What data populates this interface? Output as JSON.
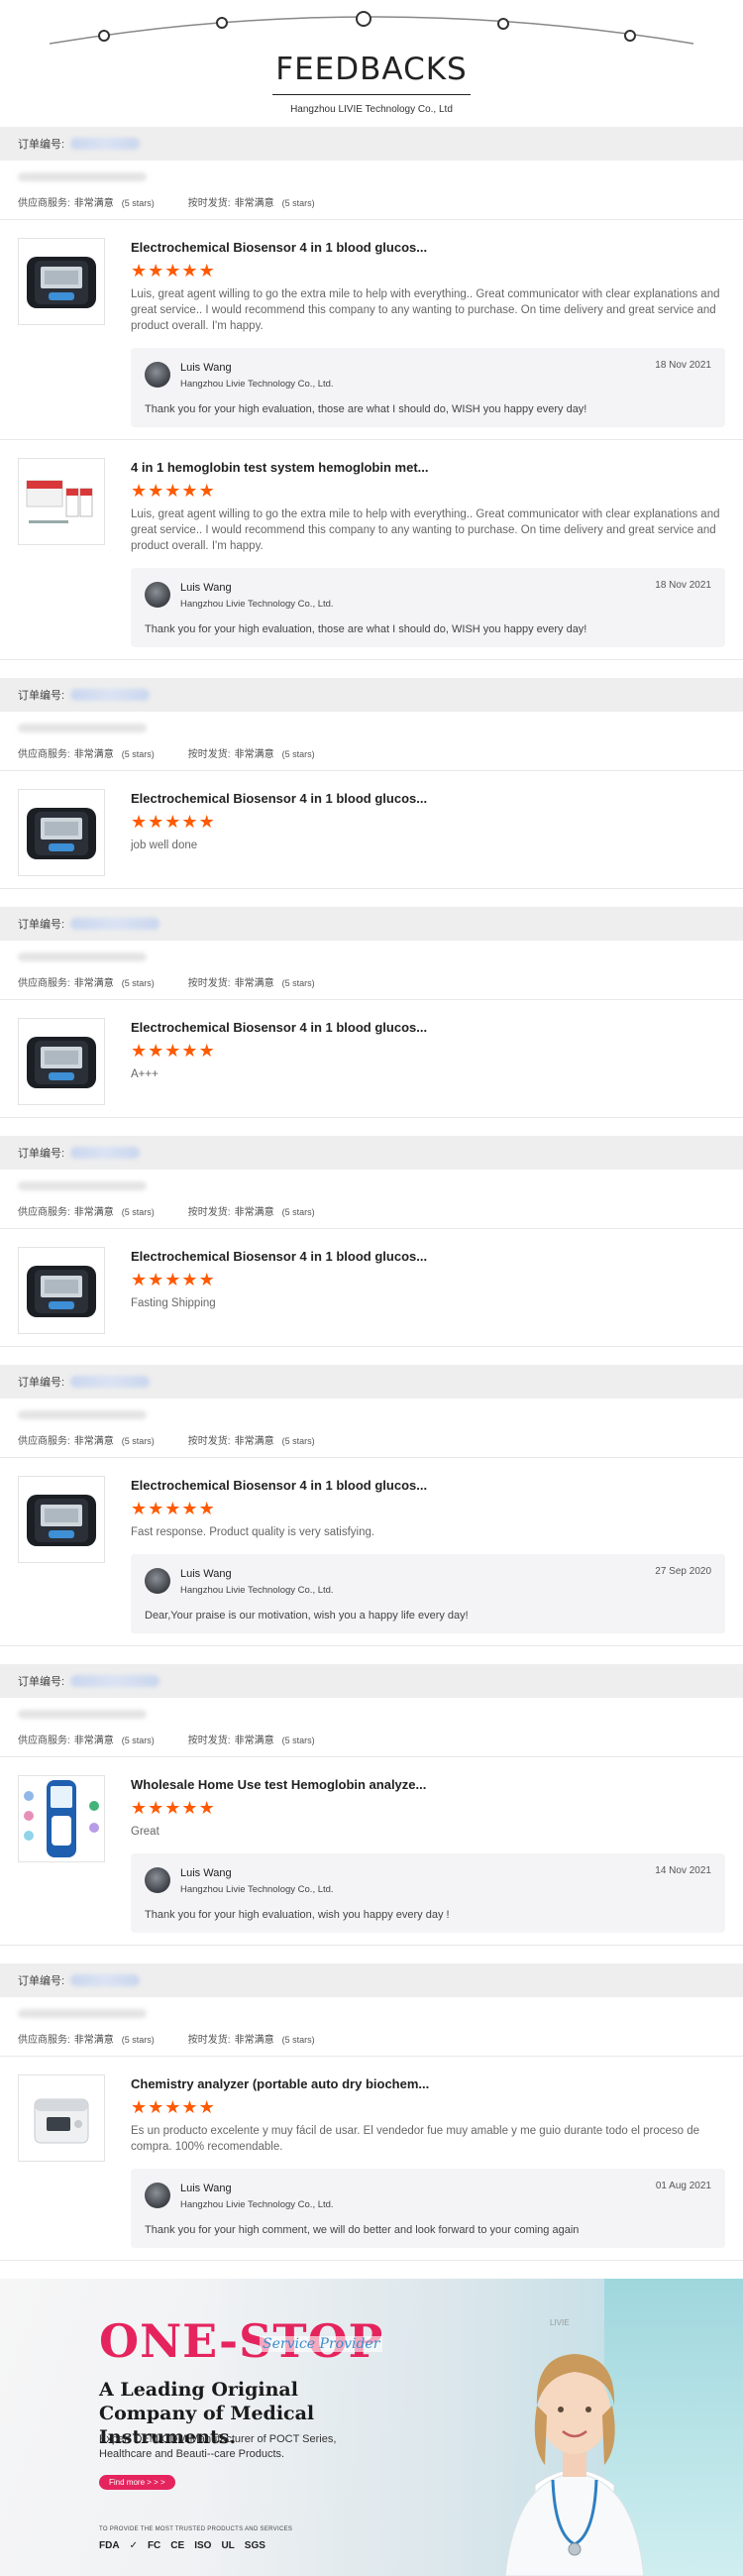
{
  "header": {
    "title": "FEEDBACKS",
    "subtitle": "Hangzhou LIVIE Technology Co., Ltd"
  },
  "labels": {
    "order_no": "订单编号:",
    "supplier_service": "供应商服务:",
    "on_time_shipping": "按时发货:",
    "very_satisfied": "非常满意",
    "five_stars": "(5 stars)"
  },
  "stars_glyph": "★★★★★",
  "orders": [
    {
      "items": [
        {
          "thumb": "glucose-meter",
          "product": "Electrochemical Biosensor 4 in 1 blood glucos...",
          "review": "Luis, great agent willing to go the extra mile to help with everything.. Great communicator with clear explanations and great service.. I would recommend this company to any wanting to purchase. On time delivery and great service and product overall. I'm happy.",
          "reply": {
            "name": "Luis Wang",
            "company": "Hangzhou Livie Technology Co., Ltd.",
            "date": "18 Nov 2021",
            "message": "Thank you for your high evaluation, those are what I should do, WISH you happy every day!"
          }
        },
        {
          "thumb": "hemoglobin-kit",
          "product": "4 in 1 hemoglobin test system hemoglobin met...",
          "review": "Luis, great agent willing to go the extra mile to help with everything.. Great communicator with clear explanations and great service.. I would recommend this company to any wanting to purchase. On time delivery and great service and product overall. I'm happy.",
          "reply": {
            "name": "Luis Wang",
            "company": "Hangzhou Livie Technology Co., Ltd.",
            "date": "18 Nov 2021",
            "message": "Thank you for your high evaluation, those are what I should do, WISH you happy every day!"
          }
        }
      ]
    },
    {
      "items": [
        {
          "thumb": "glucose-meter",
          "product": "Electrochemical Biosensor 4 in 1 blood glucos...",
          "review": "job well done"
        }
      ]
    },
    {
      "items": [
        {
          "thumb": "glucose-meter",
          "product": "Electrochemical Biosensor 4 in 1 blood glucos...",
          "review": "A+++"
        }
      ]
    },
    {
      "items": [
        {
          "thumb": "glucose-meter",
          "product": "Electrochemical Biosensor 4 in 1 blood glucos...",
          "review": "Fasting Shipping"
        }
      ]
    },
    {
      "items": [
        {
          "thumb": "glucose-meter",
          "product": "Electrochemical Biosensor 4 in 1 blood glucos...",
          "review": "Fast response. Product quality is very satisfying.",
          "reply": {
            "name": "Luis Wang",
            "company": "Hangzhou Livie Technology Co., Ltd.",
            "date": "27 Sep 2020",
            "message": "Dear,Your praise is our motivation, wish you a happy life every day!"
          }
        }
      ]
    },
    {
      "items": [
        {
          "thumb": "hemoglobin-analyzer",
          "product": "Wholesale Home Use test Hemoglobin analyze...",
          "review": "Great",
          "reply": {
            "name": "Luis Wang",
            "company": "Hangzhou Livie Technology Co., Ltd.",
            "date": "14 Nov 2021",
            "message": "Thank you for your high evaluation, wish you happy every day !"
          }
        }
      ]
    },
    {
      "items": [
        {
          "thumb": "chemistry-analyzer",
          "product": "Chemistry analyzer (portable auto dry biochem...",
          "review": "Es un producto excelente y muy fácil de usar. El vendedor fue muy amable y me guio durante todo el proceso de compra. 100% recomendable.",
          "reply": {
            "name": "Luis Wang",
            "company": "Hangzhou Livie Technology Co., Ltd.",
            "date": "01 Aug 2021",
            "message": "Thank you for your high comment, we will do better and look forward to your coming again"
          }
        }
      ]
    }
  ],
  "banner": {
    "headline": "ONE-STOP",
    "tag": "Service Provider",
    "subheadline": "A Leading Original Company of Medical Instruments.",
    "description": "Expert OEM/ODM Manufacturer of POCT Series, Healthcare and Beauti--care Products.",
    "button": "Find more > > >",
    "note": "TO PROVIDE THE MOST TRUSTED PRODUCTS AND SERVICES",
    "certs": [
      "FDA",
      "✓",
      "FC",
      "CE",
      "ISO",
      "UL",
      "SGS"
    ],
    "logo": "LIVIE"
  }
}
